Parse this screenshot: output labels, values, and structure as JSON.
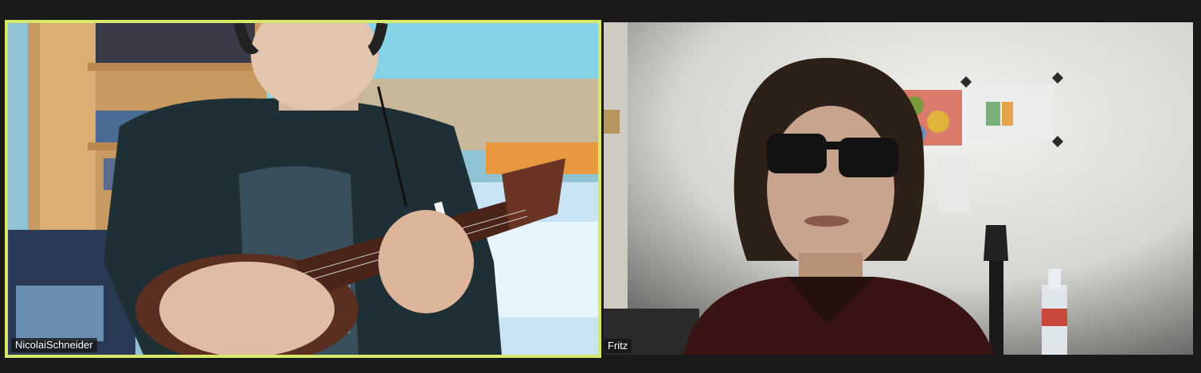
{
  "participants": [
    {
      "name": "NicolaiSchneider",
      "active_speaker": true
    },
    {
      "name": "Fritz",
      "active_speaker": false
    }
  ],
  "colors": {
    "background": "#1a1a1a",
    "active_speaker_border": "#d8e86a",
    "name_tag_bg": "#141414"
  }
}
